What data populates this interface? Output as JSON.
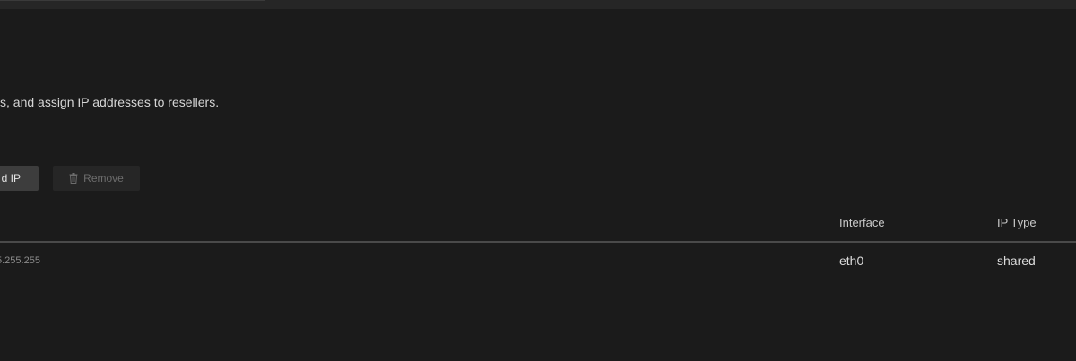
{
  "description": "s, and assign IP addresses to resellers.",
  "toolbar": {
    "add_label": "d IP",
    "remove_label": "Remove",
    "remove_icon": "trash-icon"
  },
  "table": {
    "columns": [
      "Interface",
      "IP Type"
    ],
    "rows": [
      {
        "netmask": "5.255.255",
        "interface": "eth0",
        "ip_type": "shared"
      }
    ]
  },
  "colors": {
    "background": "#1b1b1b",
    "topbar": "#262626",
    "button_primary": "#3d3d3d",
    "button_disabled": "#262626"
  }
}
